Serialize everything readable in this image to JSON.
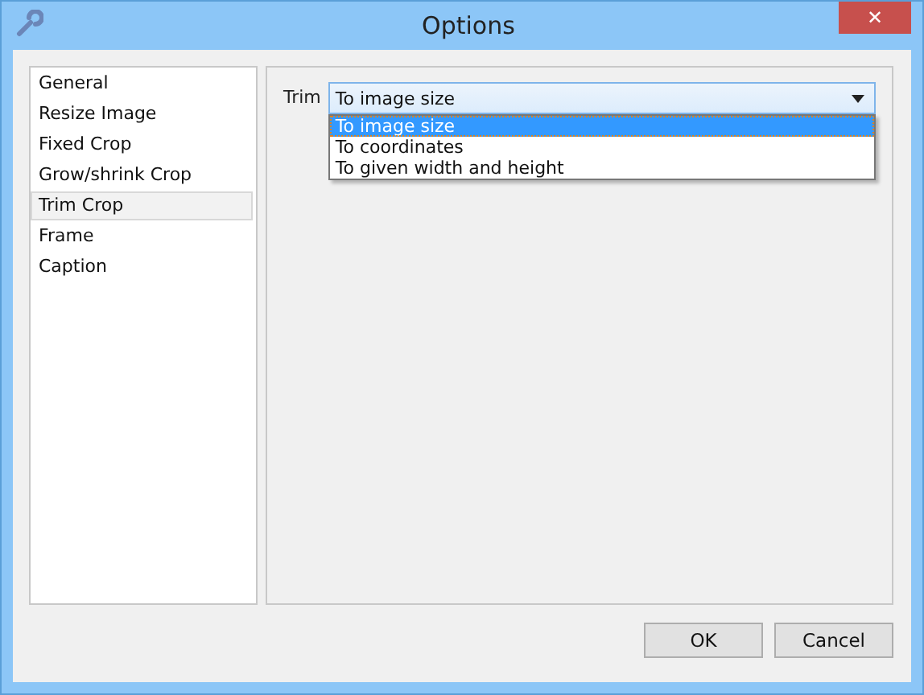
{
  "window": {
    "title": "Options",
    "close": "✕"
  },
  "sidebar": {
    "items": [
      {
        "label": "General",
        "selected": false
      },
      {
        "label": "Resize Image",
        "selected": false
      },
      {
        "label": "Fixed Crop",
        "selected": false
      },
      {
        "label": "Grow/shrink Crop",
        "selected": false
      },
      {
        "label": "Trim Crop",
        "selected": true
      },
      {
        "label": "Frame",
        "selected": false
      },
      {
        "label": "Caption",
        "selected": false
      }
    ]
  },
  "trim": {
    "label": "Trim",
    "value": "To image size",
    "expanded": true,
    "options": [
      {
        "label": "To image size",
        "selected": true
      },
      {
        "label": "To coordinates",
        "selected": false
      },
      {
        "label": "To given width and height",
        "selected": false
      }
    ]
  },
  "buttons": [
    "OK",
    "Cancel"
  ]
}
